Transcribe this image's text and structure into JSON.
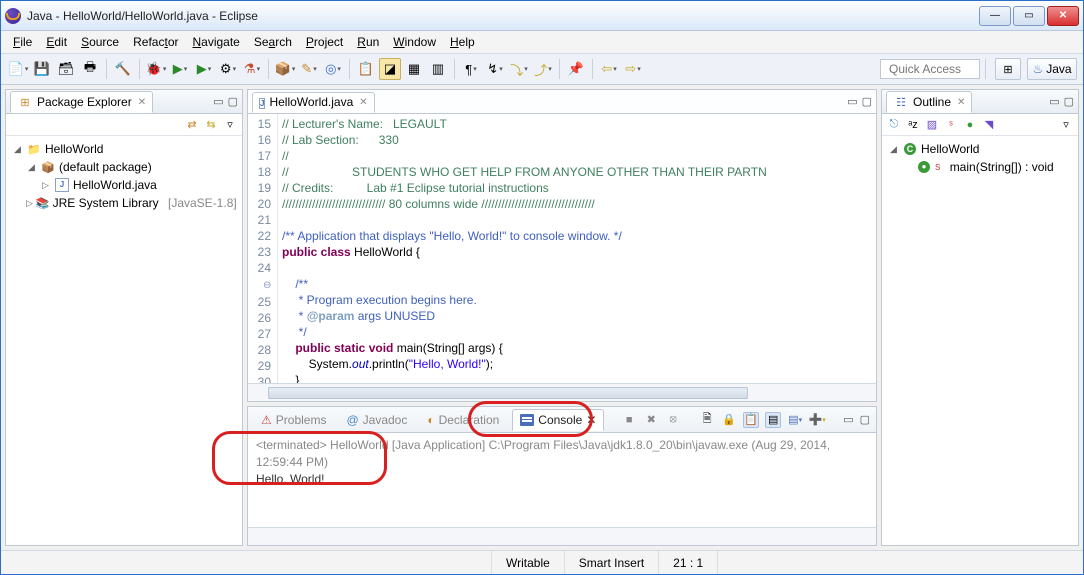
{
  "window": {
    "title": "Java - HelloWorld/HelloWorld.java - Eclipse"
  },
  "menu": {
    "file": "File",
    "edit": "Edit",
    "source": "Source",
    "refactor": "Refactor",
    "navigate": "Navigate",
    "search": "Search",
    "project": "Project",
    "run": "Run",
    "window": "Window",
    "help": "Help"
  },
  "toolbar": {
    "quick_access": "Quick Access",
    "java_persp": "Java"
  },
  "pkg_explorer": {
    "title": "Package Explorer",
    "project": "HelloWorld",
    "default_pkg": "(default package)",
    "file": "HelloWorld.java",
    "jre": "JRE System Library",
    "jre_suffix": "[JavaSE-1.8]"
  },
  "editor": {
    "tab": "HelloWorld.java",
    "lines": {
      "15": "// Lecturer's Name:   LEGAULT",
      "16": "// Lab Section:      330",
      "17": "//",
      "18": "//                   STUDENTS WHO GET HELP FROM ANYONE OTHER THAN THEIR PARTN",
      "19": "// Credits:          Lab #1 Eclipse tutorial instructions",
      "20": "/////////////////////////////// 80 columns wide //////////////////////////////////",
      "21": "",
      "22": "/** Application that displays \"Hello, World!\" to console window. */",
      "23_kw": "public class",
      "23_rest": " HelloWorld {",
      "24": "",
      "25": "    /**",
      "26": "     * Program execution begins here.",
      "27_a": "     * ",
      "27_tag": "@param",
      "27_b": " args UNUSED",
      "28": "     */",
      "29_a": "    ",
      "29_kw": "public static void",
      "29_b": " main(String[] args) {",
      "30_a": "        System.",
      "30_it": "out",
      "30_b": ".println(",
      "30_str": "\"Hello, World!\"",
      "30_c": ");",
      "31": "    }",
      "32": "}",
      "33": ""
    }
  },
  "bottom": {
    "tabs": {
      "problems": "Problems",
      "javadoc": "Javadoc",
      "declaration": "Declaration",
      "console": "Console"
    },
    "terminated": "<terminated> HelloWorld [Java Application] C:\\Program Files\\Java\\jdk1.8.0_20\\bin\\javaw.exe (Aug 29, 2014, 12:59:44 PM)",
    "output": "Hello, World!"
  },
  "outline": {
    "title": "Outline",
    "class": "HelloWorld",
    "method": "main(String[]) : void"
  },
  "status": {
    "writable": "Writable",
    "insert": "Smart Insert",
    "pos": "21 : 1"
  }
}
